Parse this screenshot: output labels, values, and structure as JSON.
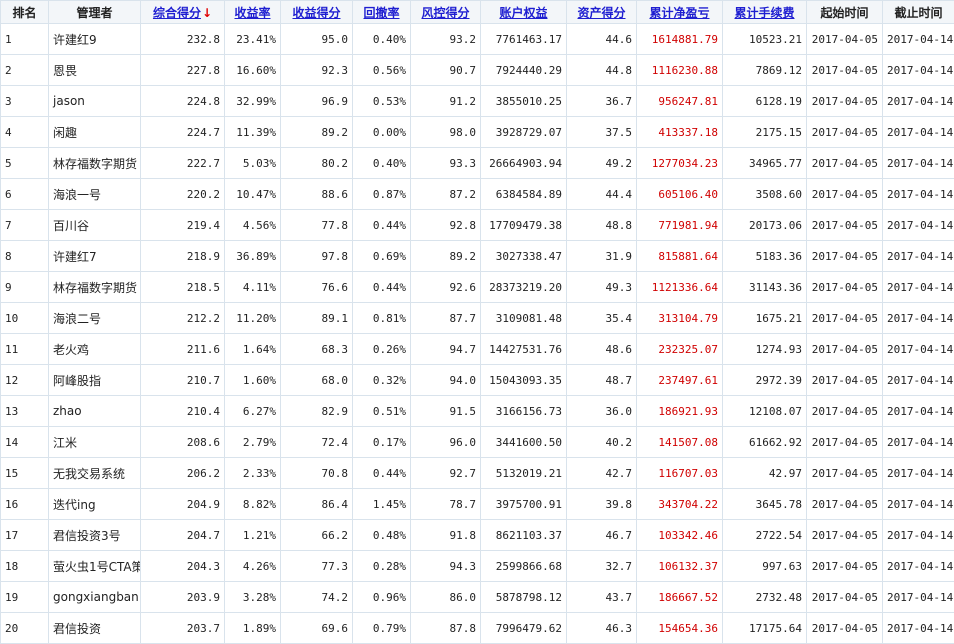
{
  "columns": [
    {
      "key": "rank",
      "label": "排名",
      "sortable": false
    },
    {
      "key": "manager",
      "label": "管理者",
      "sortable": false
    },
    {
      "key": "composite",
      "label": "综合得分",
      "sortable": true,
      "sorted": "desc"
    },
    {
      "key": "return_rate",
      "label": "收益率",
      "sortable": true
    },
    {
      "key": "return_score",
      "label": "收益得分",
      "sortable": true
    },
    {
      "key": "drawdown",
      "label": "回撤率",
      "sortable": true
    },
    {
      "key": "risk_score",
      "label": "风控得分",
      "sortable": true
    },
    {
      "key": "equity",
      "label": "账户权益",
      "sortable": true
    },
    {
      "key": "asset_score",
      "label": "资产得分",
      "sortable": true
    },
    {
      "key": "net_pl",
      "label": "累计净盈亏",
      "sortable": true
    },
    {
      "key": "fees",
      "label": "累计手续费",
      "sortable": true
    },
    {
      "key": "start",
      "label": "起始时间",
      "sortable": false
    },
    {
      "key": "end",
      "label": "截止时间",
      "sortable": false
    }
  ],
  "sort_arrow": "↓",
  "colors": {
    "link": "#1f1fd1",
    "profit": "#d00000",
    "border": "#d9e3ec",
    "header_bg": "#f3f6f9"
  },
  "rows": [
    [
      "1",
      "许建红9",
      "232.8",
      "23.41%",
      "95.0",
      "0.40%",
      "93.2",
      "7761463.17",
      "44.6",
      "1614881.79",
      "10523.21",
      "2017-04-05",
      "2017-04-14"
    ],
    [
      "2",
      "恩畏",
      "227.8",
      "16.60%",
      "92.3",
      "0.56%",
      "90.7",
      "7924440.29",
      "44.8",
      "1116230.88",
      "7869.12",
      "2017-04-05",
      "2017-04-14"
    ],
    [
      "3",
      "jason",
      "224.8",
      "32.99%",
      "96.9",
      "0.53%",
      "91.2",
      "3855010.25",
      "36.7",
      "956247.81",
      "6128.19",
      "2017-04-05",
      "2017-04-14"
    ],
    [
      "4",
      "闲趣",
      "224.7",
      "11.39%",
      "89.2",
      "0.00%",
      "98.0",
      "3928729.07",
      "37.5",
      "413337.18",
      "2175.15",
      "2017-04-05",
      "2017-04-14"
    ],
    [
      "5",
      "林存福数字期货",
      "222.7",
      "5.03%",
      "80.2",
      "0.40%",
      "93.3",
      "26664903.94",
      "49.2",
      "1277034.23",
      "34965.77",
      "2017-04-05",
      "2017-04-14"
    ],
    [
      "6",
      "海浪一号",
      "220.2",
      "10.47%",
      "88.6",
      "0.87%",
      "87.2",
      "6384584.89",
      "44.4",
      "605106.40",
      "3508.60",
      "2017-04-05",
      "2017-04-14"
    ],
    [
      "7",
      "百川谷",
      "219.4",
      "4.56%",
      "77.8",
      "0.44%",
      "92.8",
      "17709479.38",
      "48.8",
      "771981.94",
      "20173.06",
      "2017-04-05",
      "2017-04-14"
    ],
    [
      "8",
      "许建红7",
      "218.9",
      "36.89%",
      "97.8",
      "0.69%",
      "89.2",
      "3027338.47",
      "31.9",
      "815881.64",
      "5183.36",
      "2017-04-05",
      "2017-04-14"
    ],
    [
      "9",
      "林存福数字期货",
      "218.5",
      "4.11%",
      "76.6",
      "0.44%",
      "92.6",
      "28373219.20",
      "49.3",
      "1121336.64",
      "31143.36",
      "2017-04-05",
      "2017-04-14"
    ],
    [
      "10",
      "海浪二号",
      "212.2",
      "11.20%",
      "89.1",
      "0.81%",
      "87.7",
      "3109081.48",
      "35.4",
      "313104.79",
      "1675.21",
      "2017-04-05",
      "2017-04-14"
    ],
    [
      "11",
      "老火鸡",
      "211.6",
      "1.64%",
      "68.3",
      "0.26%",
      "94.7",
      "14427531.76",
      "48.6",
      "232325.07",
      "1274.93",
      "2017-04-05",
      "2017-04-14"
    ],
    [
      "12",
      "阿峰股指",
      "210.7",
      "1.60%",
      "68.0",
      "0.32%",
      "94.0",
      "15043093.35",
      "48.7",
      "237497.61",
      "2972.39",
      "2017-04-05",
      "2017-04-14"
    ],
    [
      "13",
      "zhao",
      "210.4",
      "6.27%",
      "82.9",
      "0.51%",
      "91.5",
      "3166156.73",
      "36.0",
      "186921.93",
      "12108.07",
      "2017-04-05",
      "2017-04-14"
    ],
    [
      "14",
      "江米",
      "208.6",
      "2.79%",
      "72.4",
      "0.17%",
      "96.0",
      "3441600.50",
      "40.2",
      "141507.08",
      "61662.92",
      "2017-04-05",
      "2017-04-14"
    ],
    [
      "15",
      "无我交易系统",
      "206.2",
      "2.33%",
      "70.8",
      "0.44%",
      "92.7",
      "5132019.21",
      "42.7",
      "116707.03",
      "42.97",
      "2017-04-05",
      "2017-04-14"
    ],
    [
      "16",
      "迭代ing",
      "204.9",
      "8.82%",
      "86.4",
      "1.45%",
      "78.7",
      "3975700.91",
      "39.8",
      "343704.22",
      "3645.78",
      "2017-04-05",
      "2017-04-14"
    ],
    [
      "17",
      "君信投资3号",
      "204.7",
      "1.21%",
      "66.2",
      "0.48%",
      "91.8",
      "8621103.37",
      "46.7",
      "103342.46",
      "2722.54",
      "2017-04-05",
      "2017-04-14"
    ],
    [
      "18",
      "萤火虫1号CTA策",
      "204.3",
      "4.26%",
      "77.3",
      "0.28%",
      "94.3",
      "2599866.68",
      "32.7",
      "106132.37",
      "997.63",
      "2017-04-05",
      "2017-04-14"
    ],
    [
      "19",
      "gongxiangban",
      "203.9",
      "3.28%",
      "74.2",
      "0.96%",
      "86.0",
      "5878798.12",
      "43.7",
      "186667.52",
      "2732.48",
      "2017-04-05",
      "2017-04-14"
    ],
    [
      "20",
      "君信投资",
      "203.7",
      "1.89%",
      "69.6",
      "0.79%",
      "87.8",
      "7996479.62",
      "46.3",
      "154654.36",
      "17175.64",
      "2017-04-05",
      "2017-04-14"
    ]
  ]
}
